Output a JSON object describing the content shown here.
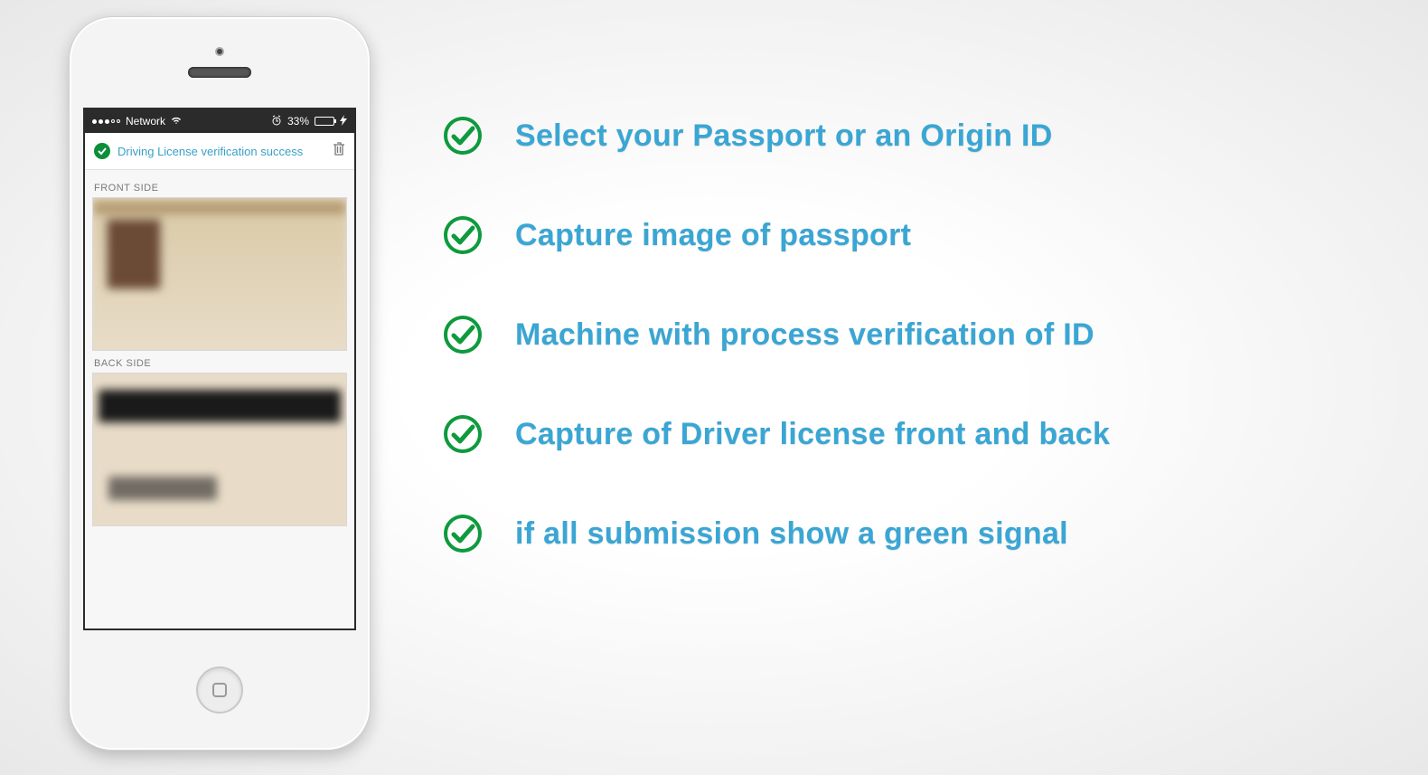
{
  "phone": {
    "statusbar": {
      "network_label": "Network",
      "battery_pct": "33%"
    },
    "verify_message": "Driving License verification success",
    "front_label": "FRONT SIDE",
    "back_label": "BACK SIDE"
  },
  "steps": [
    {
      "text": "Select your Passport or an Origin ID"
    },
    {
      "text": "Capture image of passport"
    },
    {
      "text": "Machine with process verification of ID"
    },
    {
      "text": "Capture of Driver license front and back"
    },
    {
      "text": "if all submission show a green signal"
    }
  ]
}
